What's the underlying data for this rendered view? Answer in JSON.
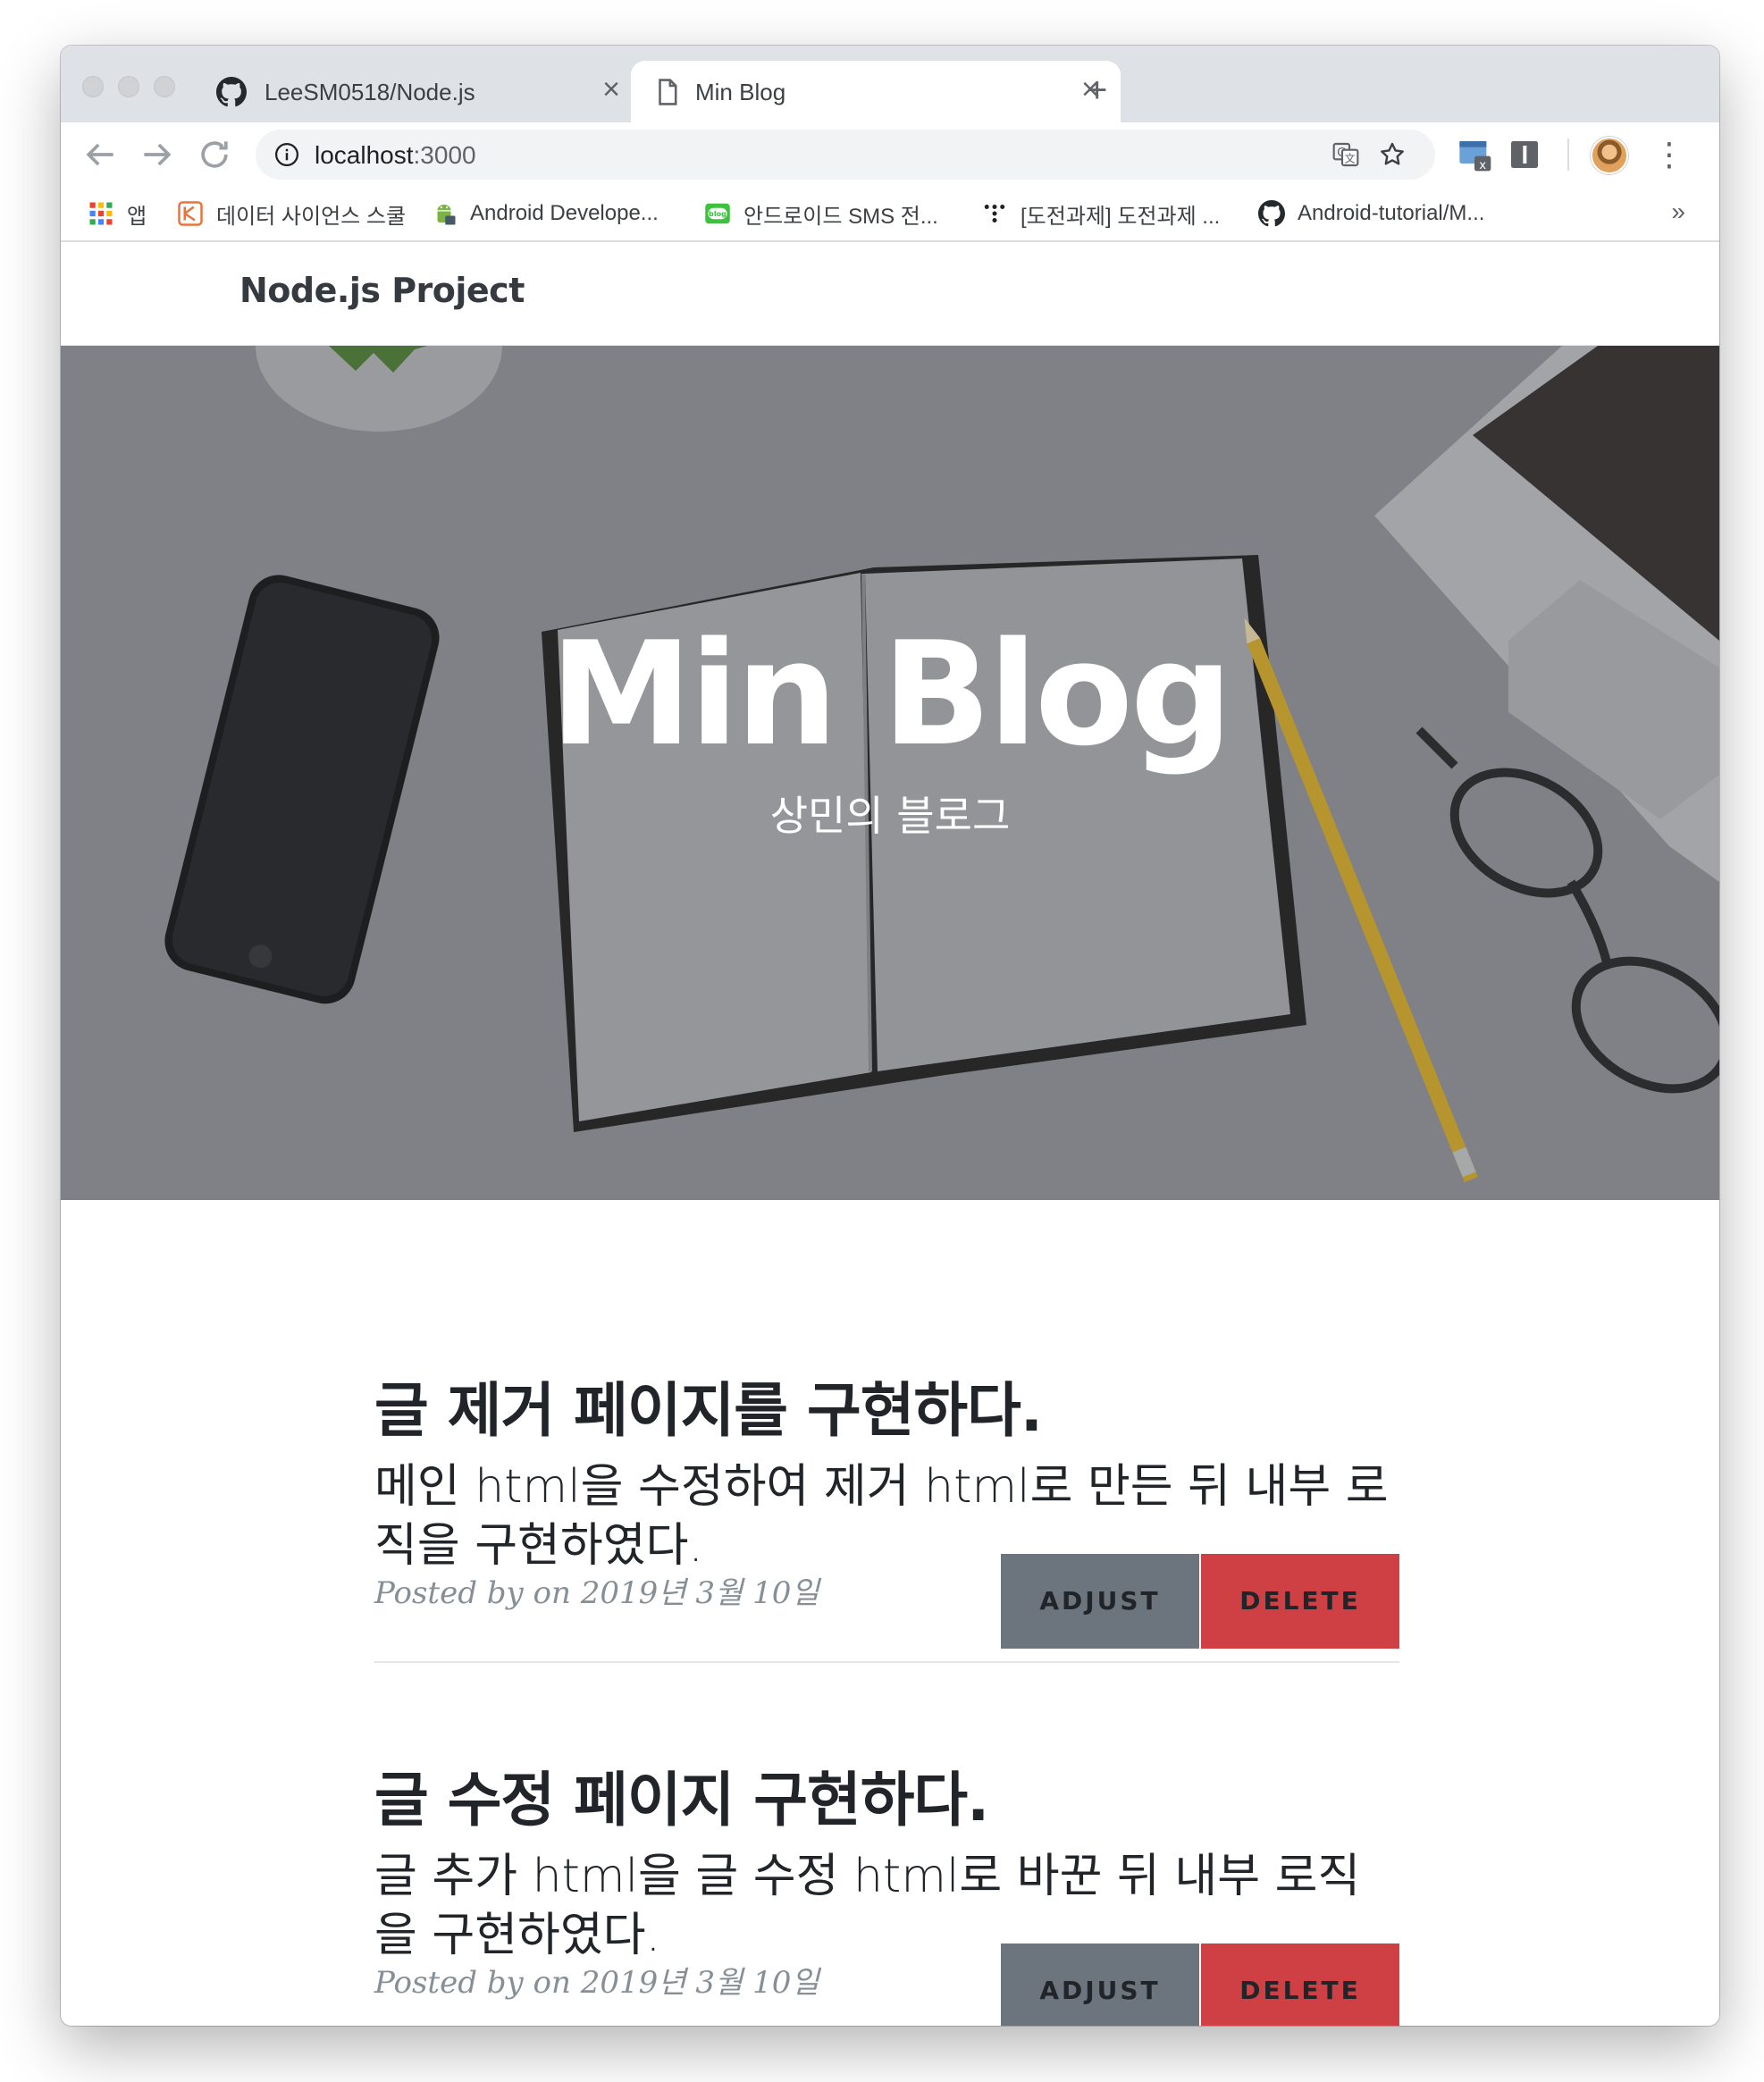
{
  "browser": {
    "tabs": [
      {
        "title": "LeeSM0518/Node.js",
        "icon": "github-icon",
        "active": false
      },
      {
        "title": "Min Blog",
        "icon": "document-icon",
        "active": true
      }
    ],
    "url": {
      "host": "localhost",
      "port": ":3000"
    },
    "bookmarks": [
      {
        "label": "앱",
        "icon": "apps-grid-icon"
      },
      {
        "label": "데이터 사이언스 스쿨",
        "icon": "datascience-icon"
      },
      {
        "label": "Android Develope...",
        "icon": "android-icon"
      },
      {
        "label": "안드로이드 SMS 전...",
        "icon": "blog-icon"
      },
      {
        "label": "[도전과제] 도전과제 ...",
        "icon": "dots-icon"
      },
      {
        "label": "Android-tutorial/M...",
        "icon": "github-icon"
      }
    ],
    "bookmarks_more": "»"
  },
  "site": {
    "brand": "Node.js Project",
    "hero": {
      "title": "Min Blog",
      "subtitle": "상민의 블로그"
    },
    "posts": [
      {
        "title": "글 제거 페이지를 구현하다.",
        "subtitle": "메인 html을 수정하여 제거 html로 만든 뒤 내부 로직을 구현하였다.",
        "meta": "Posted by on 2019년 3월 10일",
        "adjust_label": "ADJUST",
        "delete_label": "DELETE"
      },
      {
        "title": "글 수정 페이지 구현하다.",
        "subtitle": "글 추가 html을 글 수정 html로 바꾼 뒤 내부 로직을 구현하였다.",
        "meta": "Posted by on 2019년 3월 10일",
        "adjust_label": "ADJUST",
        "delete_label": "DELETE"
      }
    ]
  },
  "colors": {
    "adjust": "#6c757d",
    "delete": "#cf4045",
    "meta": "#868e96"
  }
}
